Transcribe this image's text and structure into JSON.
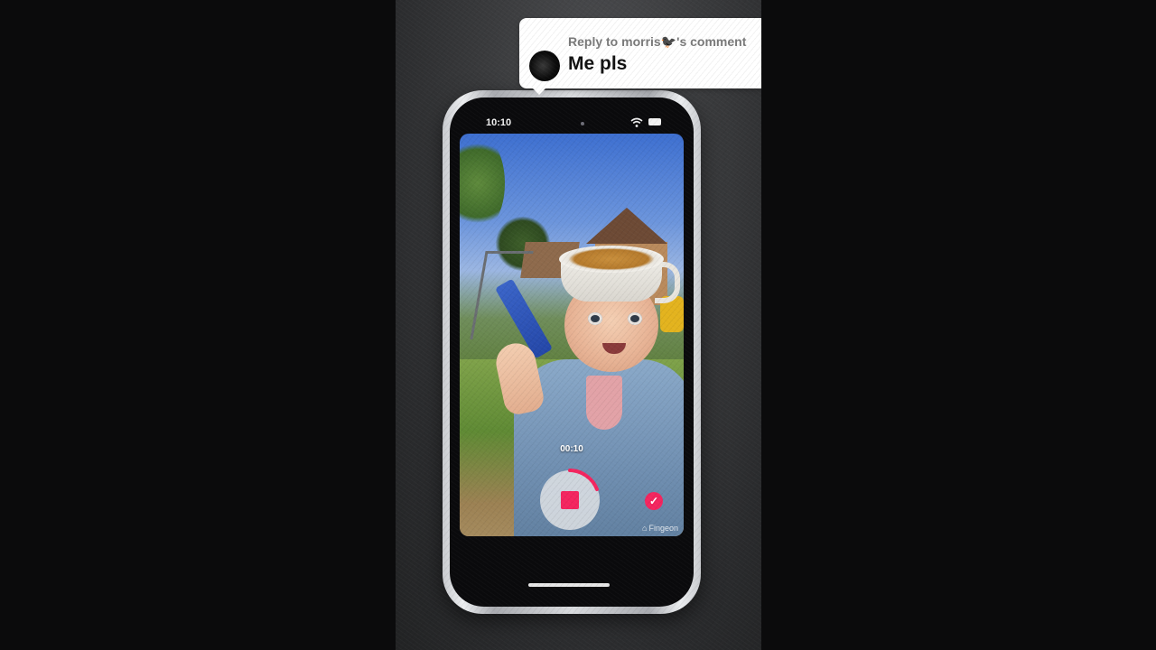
{
  "reply": {
    "prefix": "Reply to ",
    "username": "morris",
    "emoji": "🐦‍⬛",
    "suffix": "'s comment",
    "comment": "Me pls"
  },
  "phone": {
    "status_time": "10:10",
    "recording_timer": "00:10",
    "watermark": "Fingeon",
    "accent_color": "#f4255f"
  },
  "icons": {
    "avatar": "commenter-avatar",
    "wifi": "wifi-icon",
    "battery": "battery-icon",
    "record": "stop-record-icon",
    "confirm": "checkmark-icon",
    "watermark": "app-logo-icon"
  }
}
